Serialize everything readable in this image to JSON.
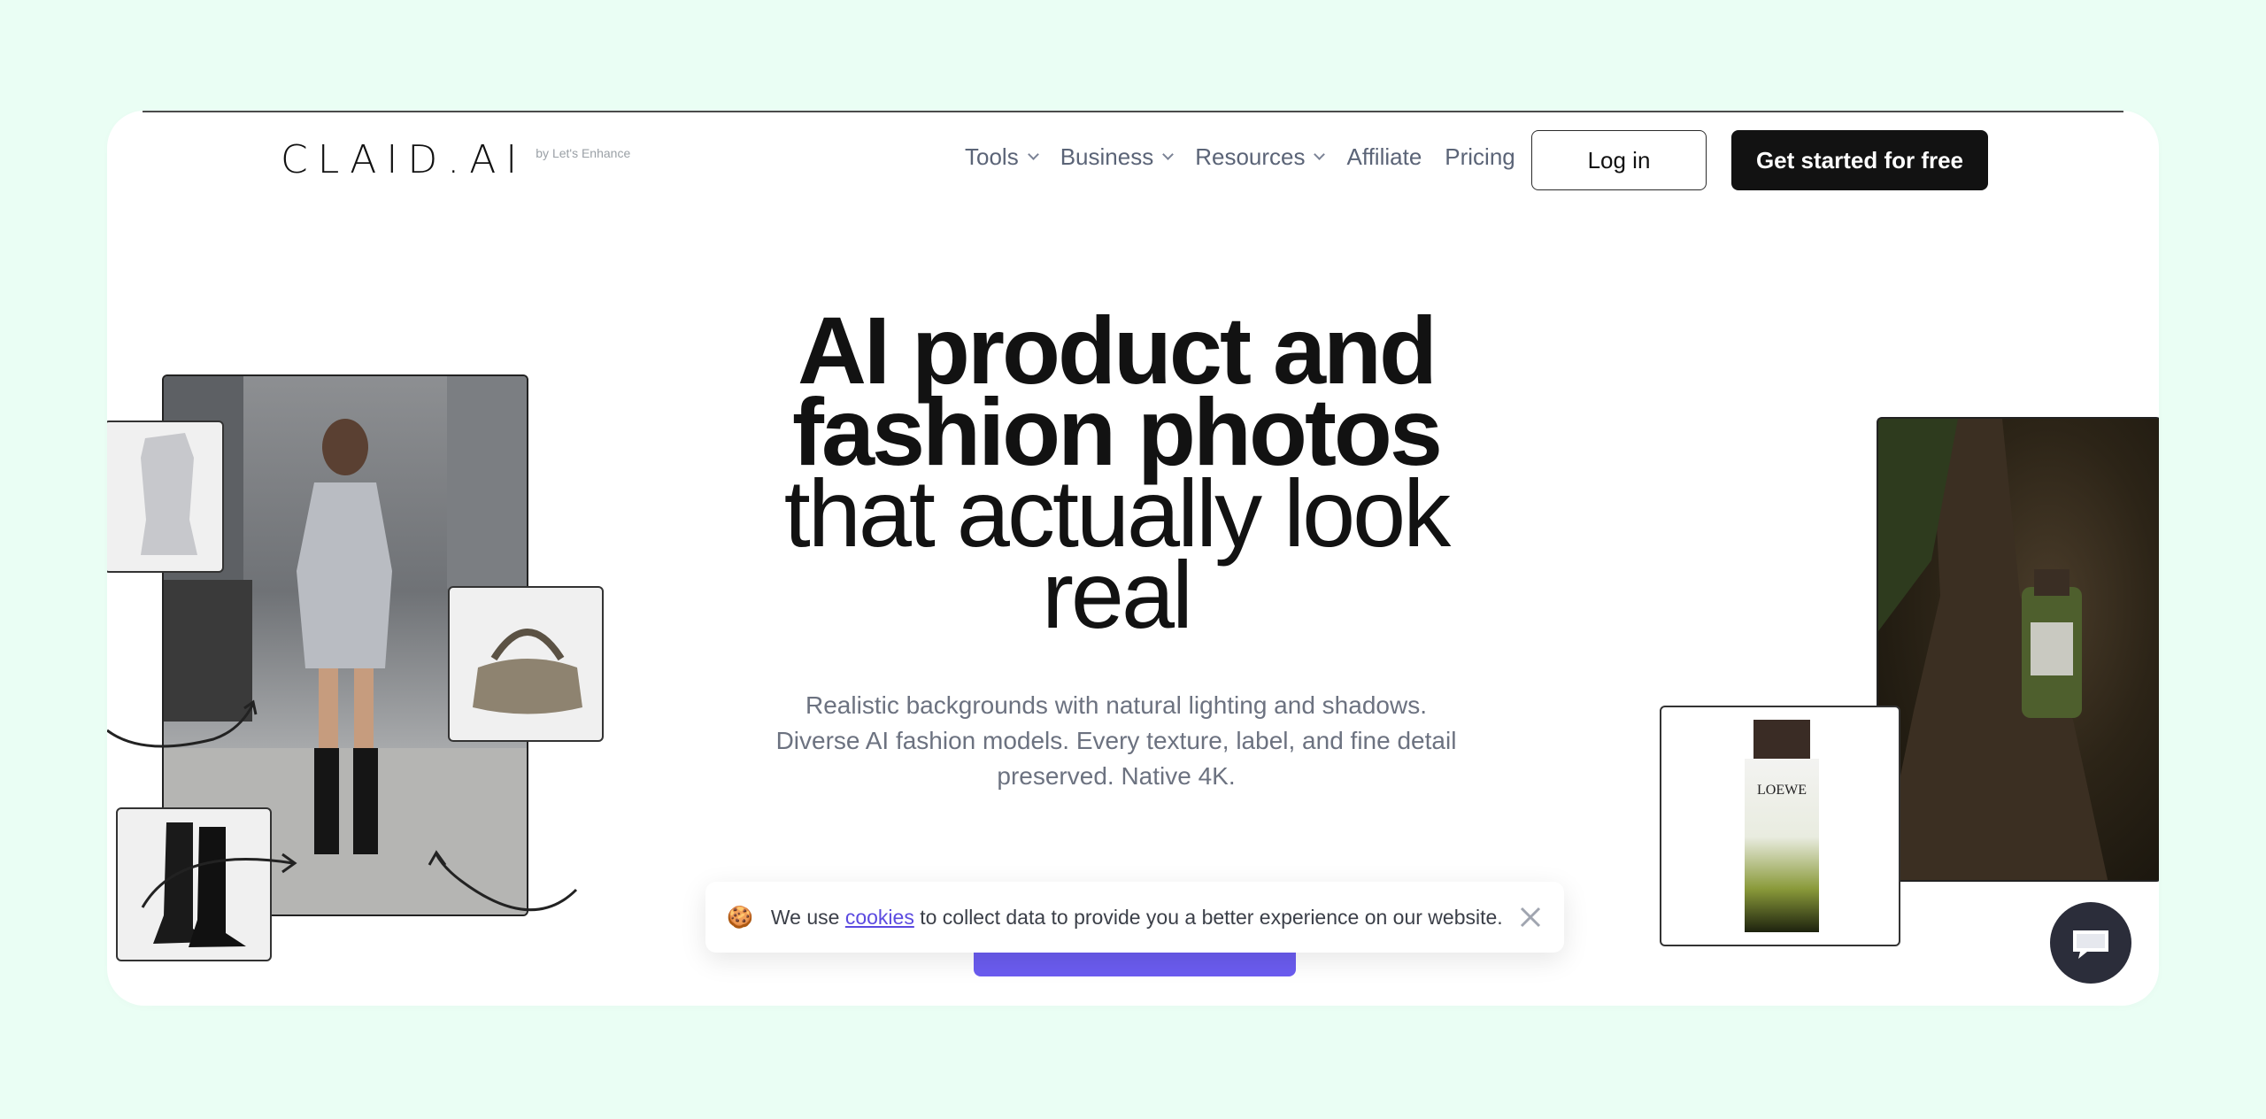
{
  "logo": {
    "text": "CLAID.AI",
    "sub": "by Let's Enhance"
  },
  "nav": {
    "items": [
      {
        "label": "Tools",
        "dropdown": true
      },
      {
        "label": "Business",
        "dropdown": true
      },
      {
        "label": "Resources",
        "dropdown": true
      },
      {
        "label": "Affiliate",
        "dropdown": false
      },
      {
        "label": "Pricing",
        "dropdown": false
      }
    ],
    "login": "Log in",
    "cta": "Get started for free"
  },
  "hero": {
    "title_bold_1": "AI product and",
    "title_bold_2": "fashion photos",
    "title_light_1": "that actually look",
    "title_light_2": "real",
    "subtitle": "Realistic backgrounds with natural lighting and shadows. Diverse AI fashion models. Every texture, label, and fine detail preserved. Native 4K."
  },
  "cookie": {
    "emoji": "🍪",
    "prefix": "We use ",
    "link": "cookies",
    "suffix": " to collect data to provide you a better experience on our website."
  },
  "perfume_label": {
    "brand": "LOEWE"
  },
  "colors": {
    "background": "#eafef4",
    "cta": "#121212",
    "accent": "#6b5cf0",
    "chat": "#2b2d3a"
  },
  "icons": {
    "cookie_close": "close-icon",
    "chat": "chat-icon",
    "chevron": "chevron-down-icon"
  }
}
